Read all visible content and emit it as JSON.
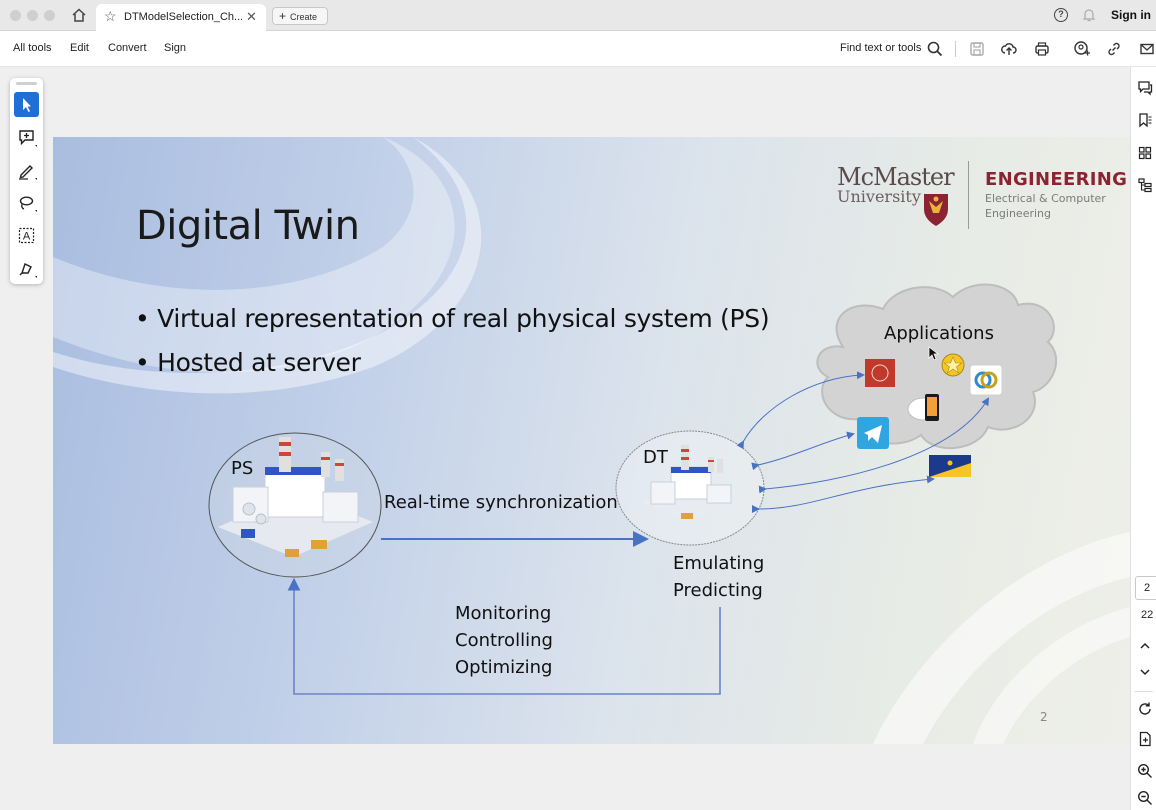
{
  "browser": {
    "tab_title": "DTModelSelection_Ch...",
    "create_label": "Create",
    "sign_in": "Sign in"
  },
  "toolbar": {
    "menu": [
      "All tools",
      "Edit",
      "Convert",
      "Sign"
    ],
    "find_label": "Find text or tools"
  },
  "pagination": {
    "current_page": "2",
    "total_pages": "22"
  },
  "slide": {
    "title": "Digital Twin",
    "bullets": [
      "• Virtual representation of real physical system (PS)",
      "• Hosted at server"
    ],
    "logo": {
      "mcmaster": "McMaster",
      "university": "University",
      "engineering": "ENGINEERING",
      "dept_line1": "Electrical & Computer",
      "dept_line2": "Engineering"
    },
    "diagram": {
      "ps_label": "PS",
      "dt_label": "DT",
      "sync_label": "Real-time synchronization",
      "emulating": "Emulating",
      "predicting": "Predicting",
      "monitoring": "Monitoring",
      "controlling": "Controlling",
      "optimizing": "Optimizing",
      "applications": "Applications"
    },
    "page_number": "2"
  },
  "colors": {
    "accent_blue": "#1f6fd6",
    "arrow_blue": "#4a72c4",
    "engineering_maroon": "#8c2332"
  }
}
